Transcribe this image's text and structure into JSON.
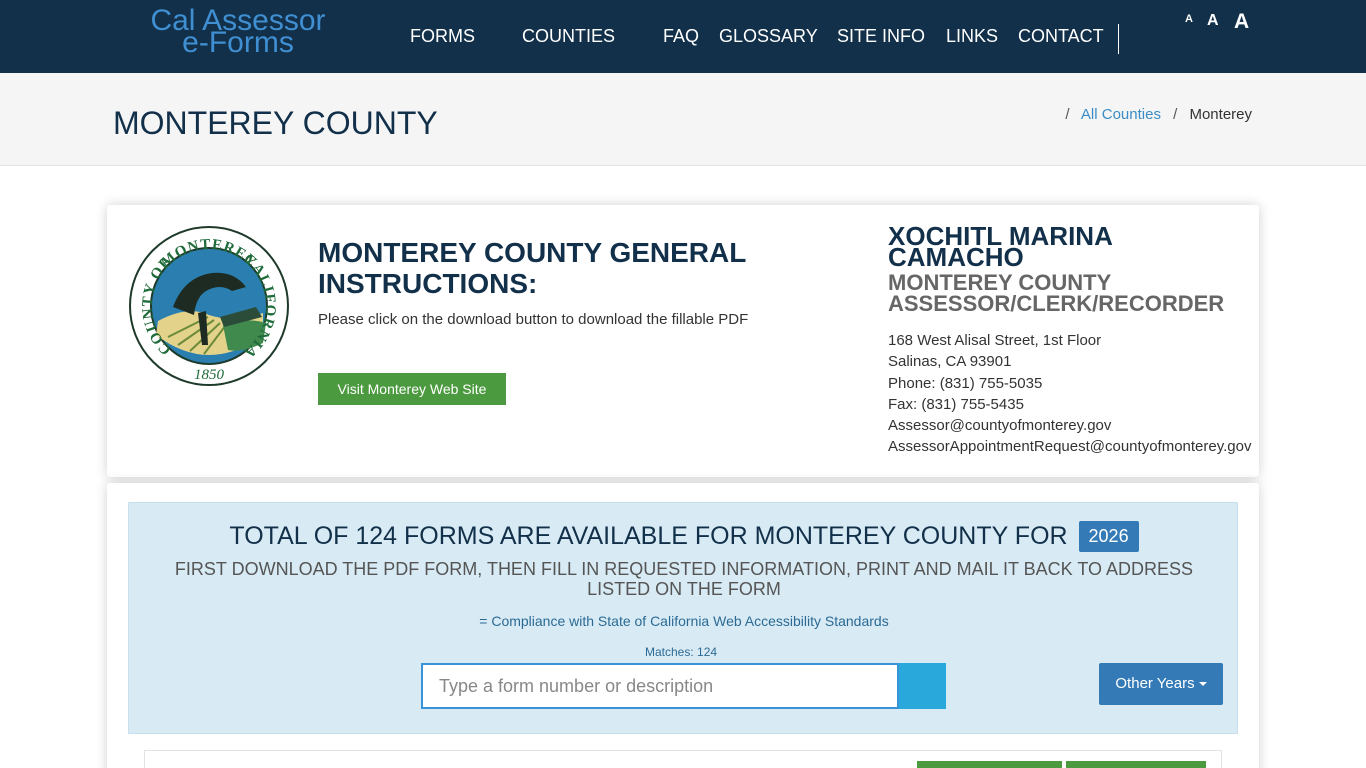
{
  "nav": {
    "logo_line1": "Cal Assessor",
    "logo_line2": "e-Forms",
    "home_icon": "home-icon",
    "items": [
      {
        "label": "FORMS",
        "has_dropdown": true
      },
      {
        "label": "COUNTIES",
        "has_dropdown": true
      },
      {
        "label": "FAQ"
      },
      {
        "label": "GLOSSARY"
      },
      {
        "label": "SITE INFO"
      },
      {
        "label": "LINKS"
      },
      {
        "label": "CONTACT"
      }
    ],
    "font_size_small": "A",
    "font_size_medium": "A",
    "font_size_large": "A",
    "bg_color": "#12304a",
    "glyph": ""
  },
  "header": {
    "title": "MONTEREY COUNTY",
    "breadcrumb": {
      "home_glyph": "",
      "sep": "/",
      "link": "All Counties",
      "current": "Monterey"
    }
  },
  "county": {
    "seal_top_text": "COUNTY OF MONTEREY CALIFORNIA",
    "seal_year": "1850",
    "instructions_title": "MONTEREY COUNTY GENERAL INSTRUCTIONS:",
    "instructions_text": "Please click on the download button to download the fillable PDF",
    "visit_button": "Visit Monterey Web Site ",
    "assessor_name": "XOCHITL MARINA CAMACHO",
    "assessor_title": "MONTEREY COUNTY ASSESSOR/CLERK/RECORDER",
    "contact": [
      "168 West Alisal Street, 1st Floor",
      "Salinas, CA 93901",
      "Phone: (831) 755-5035",
      "Fax: (831) 755-5435",
      "Assessor@countyofmonterey.gov",
      "AssessorAppointmentRequest@countyofmonterey.gov"
    ]
  },
  "forms": {
    "heading": "TOTAL OF 124 FORMS ARE AVAILABLE FOR MONTEREY COUNTY FOR",
    "year": "2026",
    "subheading": "FIRST DOWNLOAD THE PDF FORM, THEN FILL IN REQUESTED INFORMATION, PRINT AND MAIL IT BACK TO ADDRESS LISTED ON THE FORM",
    "compliance": " = Compliance with State of California Web Accessibility Standards",
    "matches": "Matches: 124",
    "search_placeholder": "Type a form number or description",
    "search_button_glyph": "",
    "other_years": "Other Years",
    "accent_color": "#337ab7",
    "green_color": "#4c9a3f"
  }
}
